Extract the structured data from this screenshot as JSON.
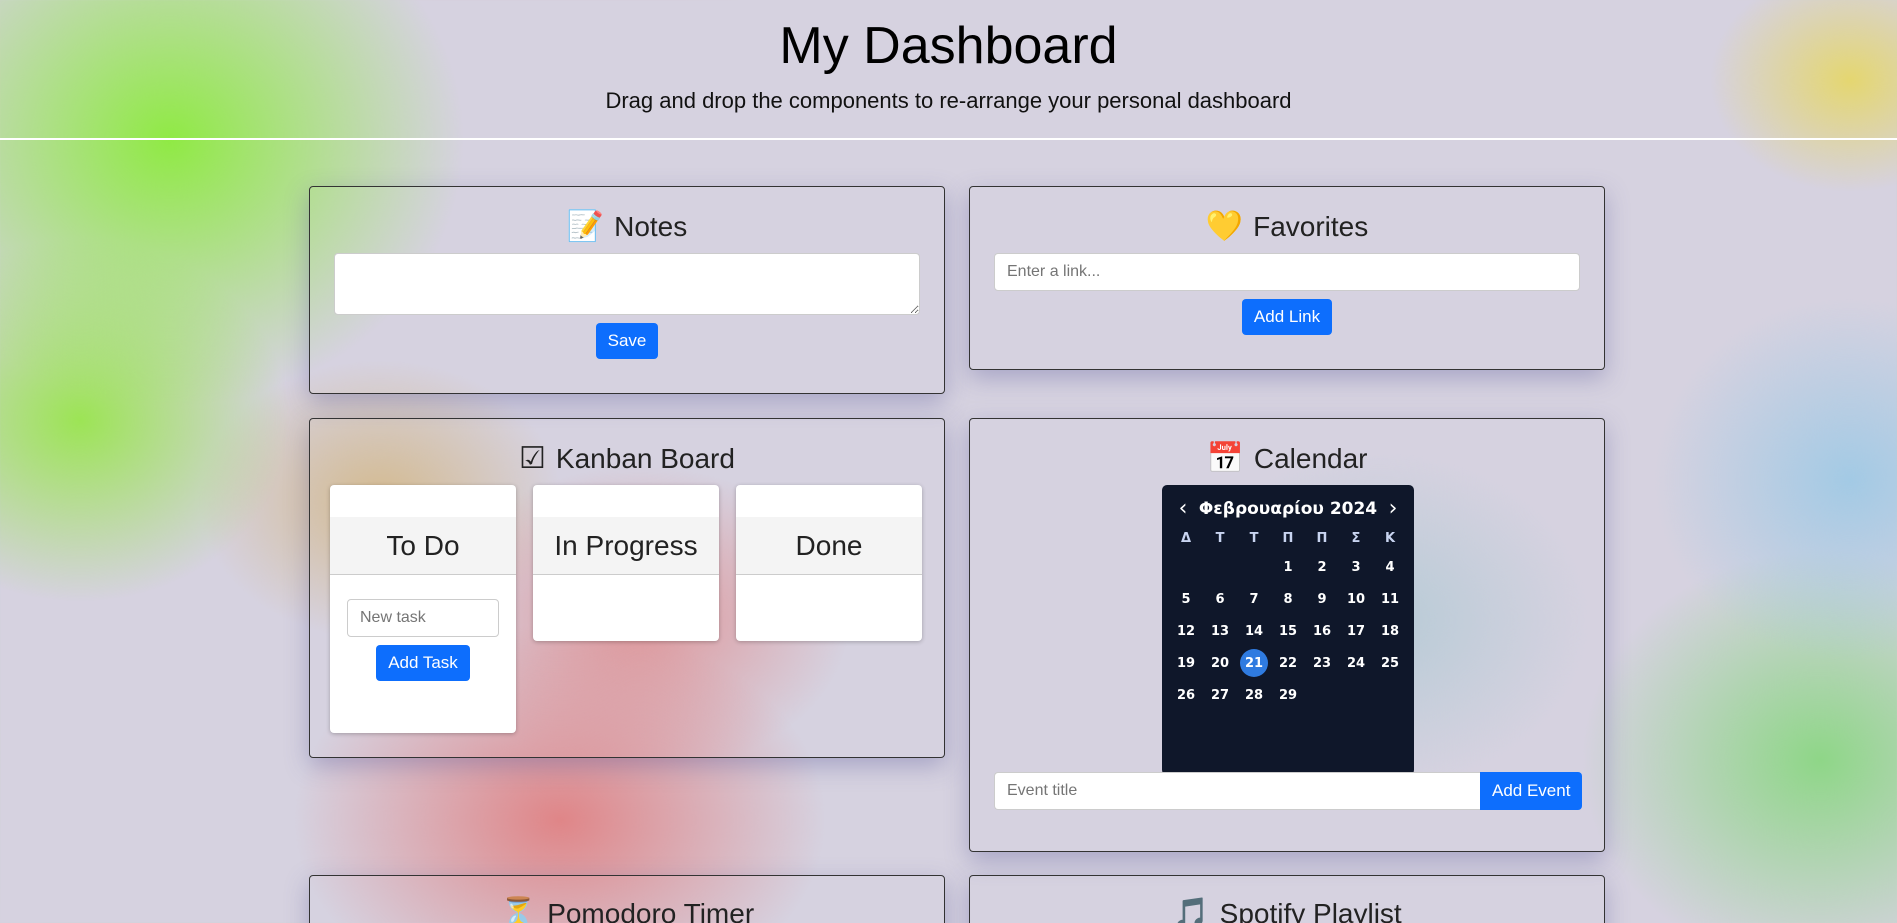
{
  "header": {
    "title": "My Dashboard",
    "subtitle": "Drag and drop the components to re-arrange your personal dashboard"
  },
  "notes": {
    "emoji": "📝",
    "title": "Notes",
    "textarea_value": "",
    "save_label": "Save"
  },
  "favorites": {
    "emoji": "💛",
    "title": "Favorites",
    "link_placeholder": "Enter a link...",
    "add_label": "Add Link"
  },
  "kanban": {
    "emoji": "☑",
    "title": "Kanban Board",
    "columns": [
      {
        "title": "To Do"
      },
      {
        "title": "In Progress"
      },
      {
        "title": "Done"
      }
    ],
    "new_task_placeholder": "New task",
    "add_task_label": "Add Task"
  },
  "calendar": {
    "emoji": "📅",
    "title": "Calendar",
    "month_label": "Φεβρουαρίου 2024",
    "prev_icon": "‹",
    "next_icon": "›",
    "weekdays": [
      "Δ",
      "Τ",
      "Τ",
      "Π",
      "Π",
      "Σ",
      "Κ"
    ],
    "leading_blanks": 3,
    "days_in_month": 29,
    "today": 21,
    "event_placeholder": "Event title",
    "add_event_label": "Add Event"
  },
  "pomodoro": {
    "emoji": "⏳",
    "title": "Pomodoro Timer"
  },
  "spotify": {
    "emoji": "🎵",
    "title": "Spotify Playlist"
  },
  "colors": {
    "accent": "#0d6efd",
    "calendar_bg": "#0f172a",
    "calendar_today": "#2f7be0"
  }
}
